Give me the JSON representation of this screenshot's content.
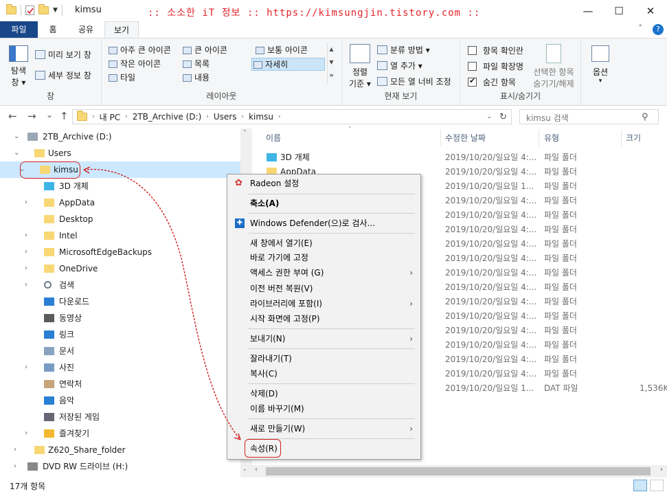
{
  "window": {
    "title": "kimsu",
    "banner": ":: 소소한 iT 정보 :: https://kimsungjin.tistory.com ::",
    "minimize": "—",
    "maximize": "☐",
    "close": "✕",
    "help": "?",
    "collapse": "˄"
  },
  "ribbon_tabs": [
    "파일",
    "홈",
    "공유",
    "보기"
  ],
  "ribbon": {
    "pane_group": {
      "nav_pane_line1": "탐색",
      "nav_pane_line2": "창 ▾",
      "preview": "미리 보기 창",
      "details": "세부 정보 창",
      "label": "창"
    },
    "layout_group": {
      "items": [
        "아주 큰 아이콘",
        "큰 아이콘",
        "보통 아이콘",
        "작은 아이콘",
        "목록",
        "자세히",
        "타일",
        "내용"
      ],
      "selected": "자세히",
      "label": "레이아웃"
    },
    "view_group": {
      "sort_line1": "정렬",
      "sort_line2": "기준 ▾",
      "group_by": "분류 방법 ▾",
      "add_col": "열 추가 ▾",
      "fit_cols": "모든 열 너비 조정",
      "label": "현재 보기"
    },
    "show_group": {
      "item_checkbox": "항목 확인란",
      "extensions": "파일 확장명",
      "hidden": "숨긴 항목",
      "hide_sel_line1": "선택한 항목",
      "hide_sel_line2": "숨기기/해제",
      "label": "표시/숨기기"
    },
    "options": {
      "label": "옵션",
      "arrow": "▾"
    }
  },
  "address": {
    "back": "←",
    "forward": "→",
    "recent": "⌄",
    "up": "↑",
    "segments": [
      "내 PC",
      "2TB_Archive (D:)",
      "Users",
      "kimsu"
    ],
    "refresh": "↻",
    "search_placeholder": "kimsu 검색"
  },
  "nav_tree": [
    {
      "label": "2TB_Archive (D:)",
      "icon": "drive-icon",
      "expand": "⌄"
    },
    {
      "label": "Users",
      "icon": "folder-icon",
      "expand": "⌄"
    },
    {
      "label": "kimsu",
      "icon": "folder-icon",
      "expand": "⌄"
    },
    {
      "label": "3D 개체",
      "icon": "3d-objects-icon",
      "expand": ""
    },
    {
      "label": "AppData",
      "icon": "folder-icon",
      "expand": "›"
    },
    {
      "label": "Desktop",
      "icon": "folder-icon",
      "expand": ""
    },
    {
      "label": "Intel",
      "icon": "folder-icon",
      "expand": "›"
    },
    {
      "label": "MicrosoftEdgeBackups",
      "icon": "folder-icon",
      "expand": "›"
    },
    {
      "label": "OneDrive",
      "icon": "folder-icon",
      "expand": "›"
    },
    {
      "label": "검색",
      "icon": "search-icon",
      "expand": "›"
    },
    {
      "label": "다운로드",
      "icon": "download-icon",
      "expand": ""
    },
    {
      "label": "동영상",
      "icon": "video-icon",
      "expand": ""
    },
    {
      "label": "링크",
      "icon": "link-icon",
      "expand": ""
    },
    {
      "label": "문서",
      "icon": "document-icon",
      "expand": ""
    },
    {
      "label": "사진",
      "icon": "picture-icon",
      "expand": "›"
    },
    {
      "label": "연락처",
      "icon": "contacts-icon",
      "expand": ""
    },
    {
      "label": "음악",
      "icon": "music-icon",
      "expand": ""
    },
    {
      "label": "저장된 게임",
      "icon": "saved-games-icon",
      "expand": ""
    },
    {
      "label": "즐겨찾기",
      "icon": "favorites-icon",
      "expand": "›"
    },
    {
      "label": "Z620_Share_folder",
      "icon": "folder-icon",
      "expand": "›"
    },
    {
      "label": "DVD RW 드라이브 (H:)",
      "icon": "dvd-icon",
      "expand": "›"
    }
  ],
  "columns": {
    "name": "이름",
    "date": "수정한 날짜",
    "type": "유형",
    "size": "크기"
  },
  "files": [
    {
      "name": "3D 개체",
      "date": "2019/10/20/일요일 4:...",
      "type": "파일 폴더",
      "size": ""
    },
    {
      "name": "AppData",
      "date": "2019/10/20/일요일 4:...",
      "type": "파일 폴더",
      "size": ""
    },
    {
      "name": "",
      "date": "2019/10/20/일요일 1...",
      "type": "파일 폴더",
      "size": ""
    },
    {
      "name": "",
      "date": "2019/10/20/일요일 4:...",
      "type": "파일 폴더",
      "size": ""
    },
    {
      "name": "",
      "date": "2019/10/20/일요일 4:...",
      "type": "파일 폴더",
      "size": ""
    },
    {
      "name": "",
      "date": "2019/10/20/일요일 4:...",
      "type": "파일 폴더",
      "size": ""
    },
    {
      "name": "",
      "date": "2019/10/20/일요일 4:...",
      "type": "파일 폴더",
      "size": ""
    },
    {
      "name": "",
      "date": "2019/10/20/일요일 4:...",
      "type": "파일 폴더",
      "size": ""
    },
    {
      "name": "",
      "date": "2019/10/20/일요일 4:...",
      "type": "파일 폴더",
      "size": ""
    },
    {
      "name": "",
      "date": "2019/10/20/일요일 4:...",
      "type": "파일 폴더",
      "size": ""
    },
    {
      "name": "",
      "date": "2019/10/20/일요일 4:...",
      "type": "파일 폴더",
      "size": ""
    },
    {
      "name": "",
      "date": "2019/10/20/일요일 4:...",
      "type": "파일 폴더",
      "size": ""
    },
    {
      "name": "",
      "date": "2019/10/20/일요일 4:...",
      "type": "파일 폴더",
      "size": ""
    },
    {
      "name": "",
      "date": "2019/10/20/일요일 4:...",
      "type": "파일 폴더",
      "size": ""
    },
    {
      "name": "",
      "date": "2019/10/20/일요일 4:...",
      "type": "파일 폴더",
      "size": ""
    },
    {
      "name": "",
      "date": "2019/10/20/일요일 4:...",
      "type": "파일 폴더",
      "size": ""
    },
    {
      "name": "",
      "date": "2019/10/20/일요일 1...",
      "type": "DAT 파일",
      "size": "1,536K"
    }
  ],
  "context_menu": {
    "radeon": "Radeon 설정",
    "collapse": "축소(A)",
    "defender": "Windows Defender(으)로 검사...",
    "open_new": "새 창에서 열기(E)",
    "pin_quick": "바로 가기에 고정",
    "grant": "액세스 권한 부여 (G)",
    "restore": "이전 버전 복원(V)",
    "library": "라이브러리에 포함(I)",
    "pin_start": "시작 화면에 고정(P)",
    "send_to": "보내기(N)",
    "cut": "잘라내기(T)",
    "copy": "복사(C)",
    "delete": "삭제(D)",
    "rename": "이름 바꾸기(M)",
    "new": "새로 만들기(W)",
    "properties": "속성(R)",
    "submenu_arrow": "›"
  },
  "status": {
    "count": "17개 항목"
  },
  "accent": "#19478a",
  "annotation_color": "#d02020"
}
